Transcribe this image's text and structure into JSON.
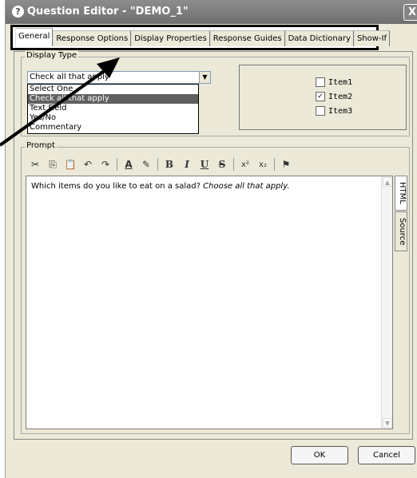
{
  "window": {
    "title": "Question Editor - \"DEMO_1\"",
    "close": "X"
  },
  "tabs": [
    "General",
    "Response Options",
    "Display Properties",
    "Response Guides",
    "Data Dictionary",
    "Show-If"
  ],
  "display_type": {
    "legend": "Display Type",
    "value": "Check all that apply",
    "options": [
      "Select One",
      "Check all that apply",
      "Text Field",
      "Yes/No",
      "Commentary"
    ],
    "selected_index": 1
  },
  "preview": {
    "items": [
      {
        "label": "Item1",
        "checked": false
      },
      {
        "label": "Item2",
        "checked": true
      },
      {
        "label": "Item3",
        "checked": false
      }
    ]
  },
  "prompt": {
    "legend": "Prompt",
    "text": "Which items do you like to eat on a salad?",
    "italic": "Choose all that apply.",
    "side_tabs": [
      "HTML",
      "Source"
    ]
  },
  "toolbar": {
    "buttons": [
      {
        "name": "cut-icon",
        "glyph": "✂"
      },
      {
        "name": "copy-icon",
        "glyph": "⎘"
      },
      {
        "name": "paste-icon",
        "glyph": "📋"
      },
      {
        "name": "undo-icon",
        "glyph": "↶"
      },
      {
        "name": "redo-icon",
        "glyph": "↷"
      },
      {
        "name": "font-color-icon",
        "glyph": "A"
      },
      {
        "name": "highlight-icon",
        "glyph": "✎"
      },
      {
        "name": "bold-icon",
        "glyph": "B"
      },
      {
        "name": "italic-icon",
        "glyph": "I"
      },
      {
        "name": "underline-icon",
        "glyph": "U"
      },
      {
        "name": "strikethrough-icon",
        "glyph": "S"
      },
      {
        "name": "superscript-icon",
        "glyph": "x²"
      },
      {
        "name": "subscript-icon",
        "glyph": "x₂"
      },
      {
        "name": "format-painter-icon",
        "glyph": "⚑"
      }
    ]
  },
  "buttons": {
    "ok": "OK",
    "cancel": "Cancel"
  },
  "colors": {
    "dialog_bg": "#ece9d8",
    "title_bar": "#7a7a7a",
    "selection": "#606060",
    "annotation": "#000000"
  }
}
